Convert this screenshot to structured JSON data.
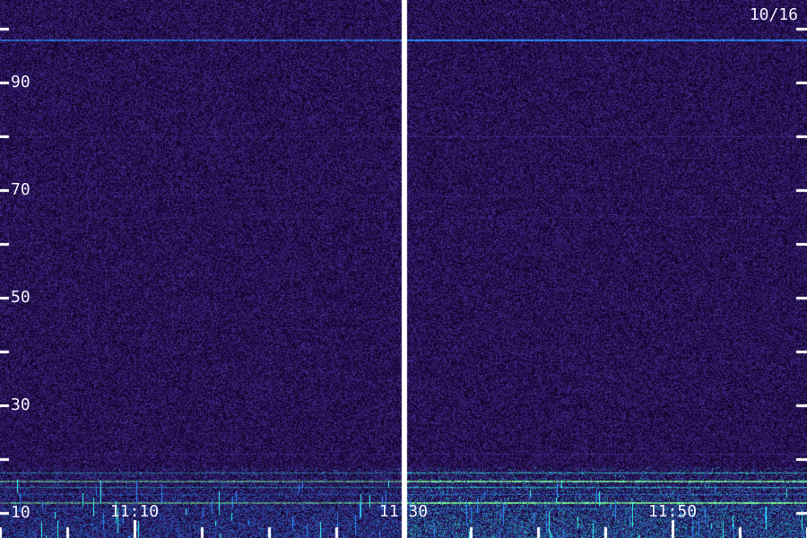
{
  "date_label": "10/16",
  "frequency_axis": {
    "tick_values": [
      10,
      20,
      30,
      40,
      50,
      60,
      70,
      80,
      90,
      100
    ],
    "labels": [
      "10",
      "30",
      "50",
      "70",
      "90"
    ],
    "range": [
      10,
      100
    ]
  },
  "time_axis": {
    "major_labels": [
      "11:10",
      "11:30",
      "11:50"
    ],
    "major_minutes": [
      10,
      30,
      50
    ],
    "minor_step_minutes": 5,
    "range_minutes": [
      0,
      60
    ],
    "gap_minute": 30
  },
  "colors": {
    "background": "#1b0840",
    "base": "#2b0f65",
    "noise_low": "#100024",
    "noise_high": "#5b3db8",
    "line_blue": "#2d8cff",
    "line_cyan": "#35ffef",
    "line_green": "#7eff96",
    "axis": "#ffffff"
  },
  "spectral_lines": [
    {
      "frequency": 98.0,
      "strength": 1.0,
      "color": "line_blue"
    },
    {
      "frequency": 80.0,
      "strength": 0.35,
      "color": "noise_high"
    },
    {
      "frequency": 69.0,
      "strength": 0.25,
      "color": "noise_high"
    },
    {
      "frequency": 65.0,
      "strength": 0.22,
      "color": "noise_high"
    },
    {
      "frequency": 21.0,
      "strength": 0.35,
      "color": "noise_high"
    },
    {
      "frequency": 17.5,
      "strength": 0.55,
      "color": "line_cyan"
    },
    {
      "frequency": 16.0,
      "strength": 0.7,
      "color": "line_green"
    },
    {
      "frequency": 14.8,
      "strength": 0.6,
      "color": "line_cyan"
    },
    {
      "frequency": 13.5,
      "strength": 0.45,
      "color": "line_blue"
    },
    {
      "frequency": 12.0,
      "strength": 0.7,
      "color": "line_green"
    },
    {
      "frequency": 10.8,
      "strength": 0.45,
      "color": "line_blue"
    }
  ]
}
